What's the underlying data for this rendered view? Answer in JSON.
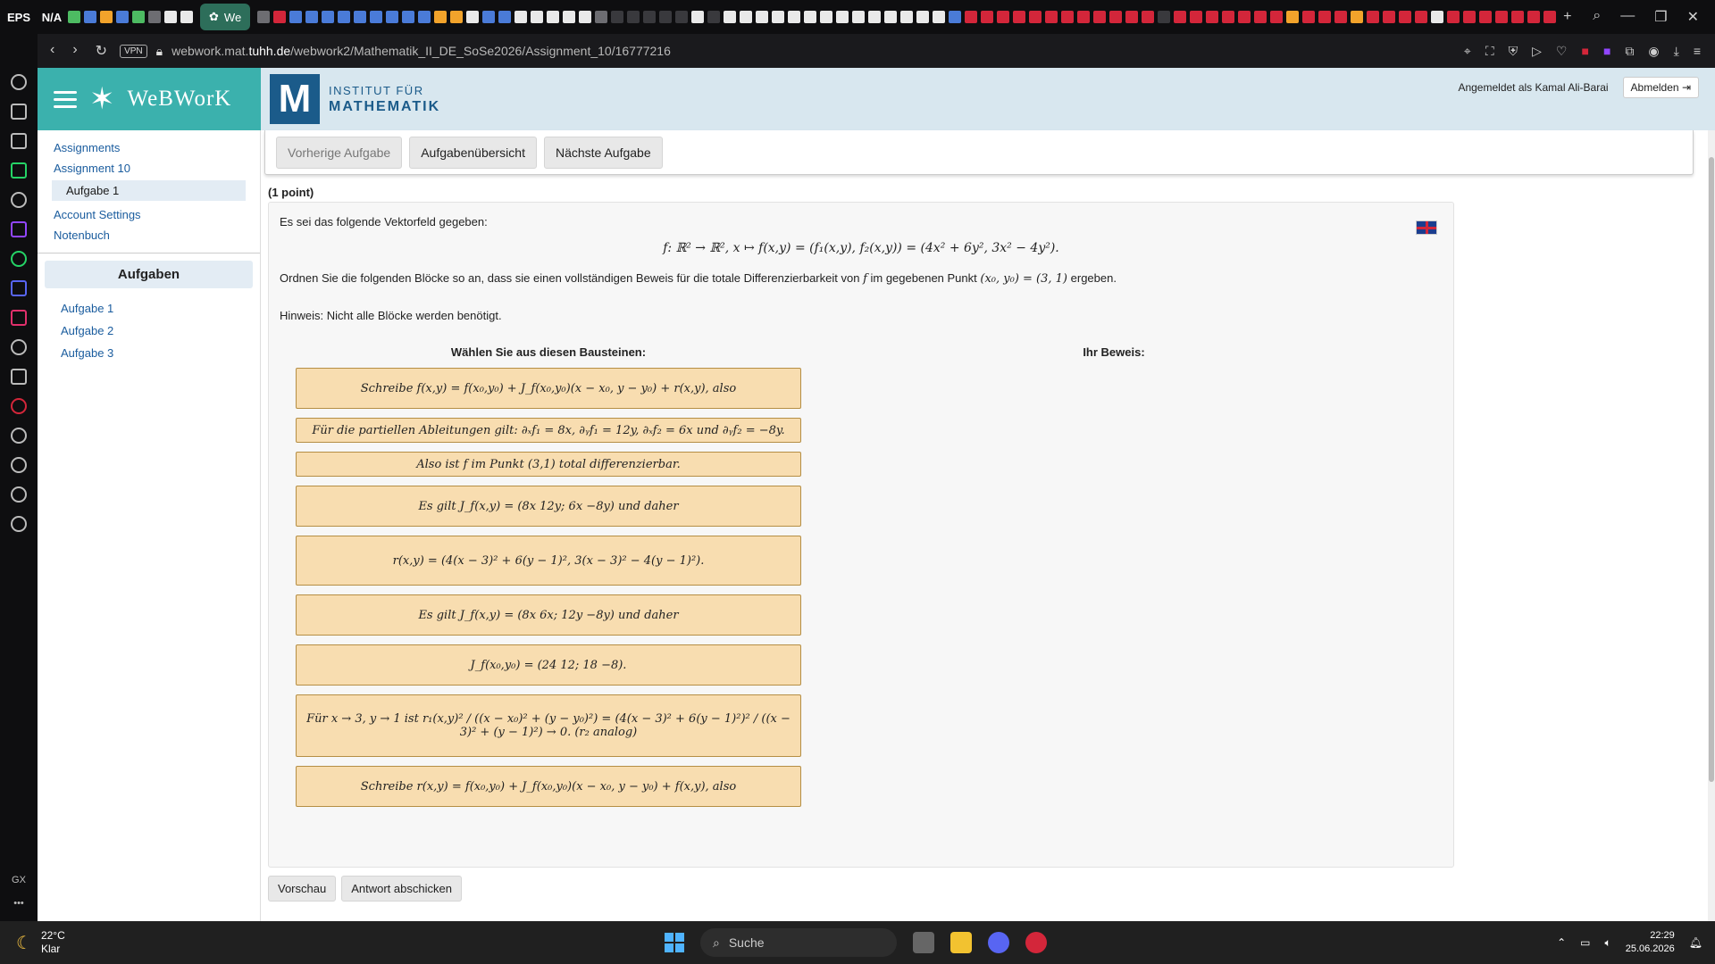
{
  "browser": {
    "tabstrip_logo1": "EPS",
    "tabstrip_logo2": "N/A",
    "active_tab_title": "We",
    "url_prefix": "webwork.mat.",
    "url_domain": "tuhh.de",
    "url_path": "/webwork2/Mathematik_II_DE_SoSe2026/Assignment_10/16777216",
    "vpn_label": "VPN"
  },
  "leftbar": {
    "bottom_label": "GX"
  },
  "header": {
    "app_name": "WeBWorK",
    "inst_line1": "INSTITUT FÜR",
    "inst_line2": "MATHEMATIK",
    "logo_letter": "M",
    "logged_in": "Angemeldet als Kamal Ali-Barai",
    "logout_label": "Abmelden"
  },
  "sidebar": {
    "assignments": "Assignments",
    "assignment": "Assignment 10",
    "current_problem": "Aufgabe 1",
    "account_settings": "Account Settings",
    "grades": "Notenbuch",
    "problems_header": "Aufgaben",
    "problems": [
      "Aufgabe 1",
      "Aufgabe 2",
      "Aufgabe 3"
    ]
  },
  "nav": {
    "prev": "Vorherige Aufgabe",
    "overview": "Aufgabenübersicht",
    "next": "Nächste Aufgabe"
  },
  "problem": {
    "points": "(1 point)",
    "intro": "Es sei das folgende Vektorfeld gegeben:",
    "formula": "f: ℝ² → ℝ², x ↦ f(x,y) = (f₁(x,y), f₂(x,y)) = (4x² + 6y², 3x² − 4y²).",
    "instruction_a": "Ordnen Sie die folgenden Blöcke so an, dass sie einen vollständigen Beweis für die totale Differenzierbarkeit von",
    "instruction_f": "f",
    "instruction_b": "im gegebenen Punkt",
    "instruction_point": "(x₀, y₀) = (3, 1)",
    "instruction_c": "ergeben.",
    "hint": "Hinweis: Nicht alle Blöcke werden benötigt.",
    "source_header": "Wählen Sie aus diesen Bausteinen:",
    "target_header": "Ihr Beweis:",
    "blocks": [
      "Schreibe f(x,y) = f(x₀,y₀) + J_f(x₀,y₀)(x − x₀, y − y₀) + r(x,y), also",
      "Für die partiellen Ableitungen gilt: ∂ₓf₁ = 8x, ∂ᵧf₁ = 12y, ∂ₓf₂ = 6x und ∂ᵧf₂ = −8y.",
      "Also ist f im Punkt (3,1) total differenzierbar.",
      "Es gilt J_f(x,y) = (8x 12y; 6x −8y) und daher",
      "r(x,y) = (4(x − 3)² + 6(y − 1)², 3(x − 3)² − 4(y − 1)²).",
      "Es gilt J_f(x,y) = (8x 6x; 12y −8y) und daher",
      "J_f(x₀,y₀) = (24 12; 18 −8).",
      "Für x → 3, y → 1 ist r₁(x,y)² / ((x − x₀)² + (y − y₀)²) = (4(x − 3)² + 6(y − 1)²)² / ((x − 3)² + (y − 1)²) → 0. (r₂ analog)",
      "Schreibe r(x,y) = f(x₀,y₀) + J_f(x₀,y₀)(x − x₀, y − y₀) + f(x,y), also"
    ],
    "preview": "Vorschau",
    "submit": "Antwort abschicken"
  },
  "taskbar": {
    "temp": "22°C",
    "weather": "Klar",
    "search": "Suche",
    "time": "22:29",
    "date": "25.06.2026"
  }
}
